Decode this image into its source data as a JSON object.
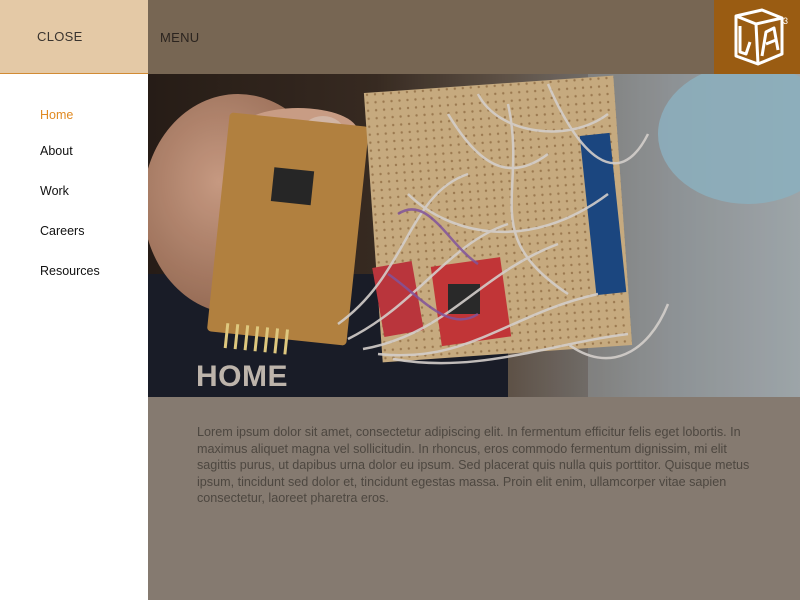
{
  "header": {
    "close_label": "CLOSE",
    "menu_label": "MENU",
    "logo_icon": "cube-logo-icon",
    "colors": {
      "header_bg": "#776653",
      "close_bg": "#e4c9a6",
      "logo_bg": "#9a5c12",
      "accent": "#e08a22"
    }
  },
  "sidebar": {
    "items": [
      {
        "label": "Home",
        "active": true
      },
      {
        "label": "About"
      },
      {
        "label": "Work"
      },
      {
        "label": "Careers"
      },
      {
        "label": "Resources"
      }
    ]
  },
  "hero": {
    "title": "HOME",
    "image_icon": "electronics-circuit-photo"
  },
  "main": {
    "body": "Lorem ipsum dolor sit amet, consectetur adipiscing elit. In fermentum efficitur felis eget lobortis. In maximus aliquet magna vel sollicitudin. In rhoncus, eros commodo fermentum dignissim, mi elit sagittis purus, ut dapibus urna dolor eu ipsum. Sed placerat quis nulla quis porttitor. Quisque metus ipsum, tincidunt sed dolor et, tincidunt egestas massa. Proin elit enim, ullamcorper vitae sapien consectetur, laoreet pharetra eros."
  }
}
